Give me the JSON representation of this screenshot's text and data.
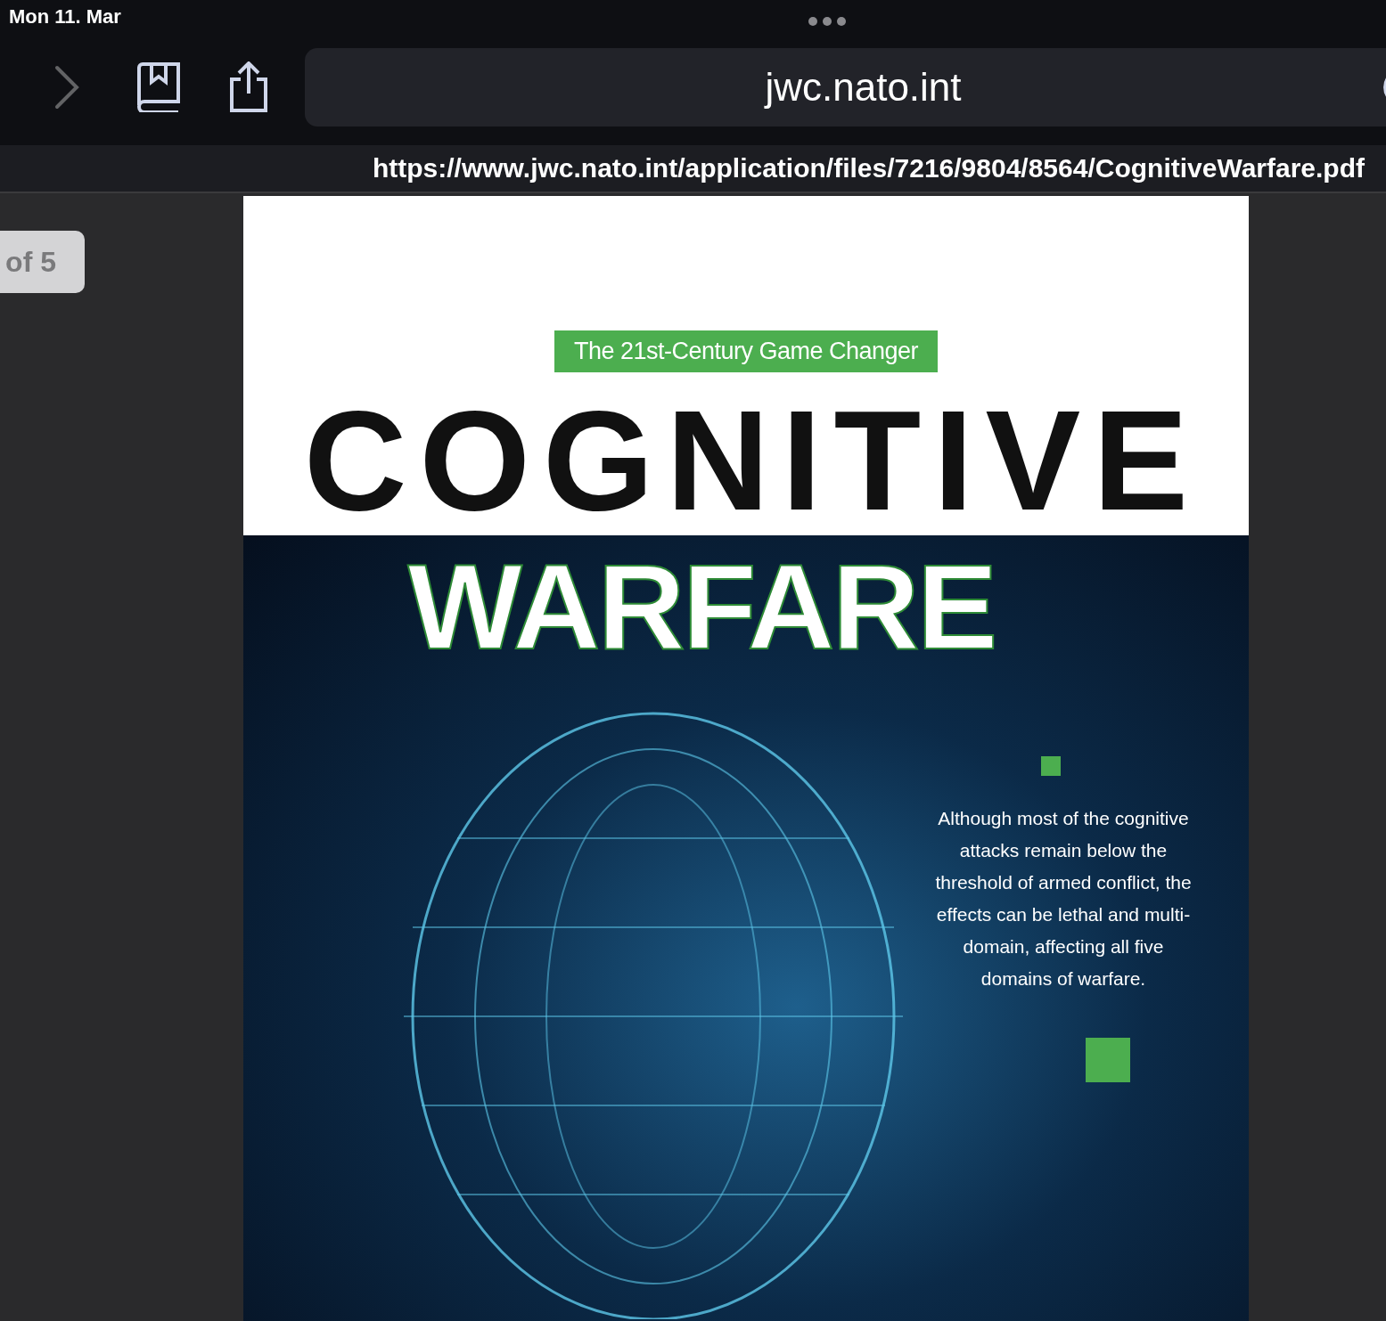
{
  "status_bar": {
    "date": "Mon 11. Mar"
  },
  "toolbar": {
    "forward": {
      "disabled": true
    },
    "address": "jwc.nato.int"
  },
  "url_bar": {
    "url": "https://www.jwc.nato.int/application/files/7216/9804/8564/CognitiveWarfare.pdf"
  },
  "page_indicator": "of 5",
  "document": {
    "tagline": "The 21st-Century Game Changer",
    "title_line_1": "COGNITIVE",
    "title_line_2": "WARFARE",
    "blurb": "Although most of the cognitive attacks remain below the threshold of armed conflict, the effects can be lethal and multi-domain, affecting all five domains of warfare."
  }
}
